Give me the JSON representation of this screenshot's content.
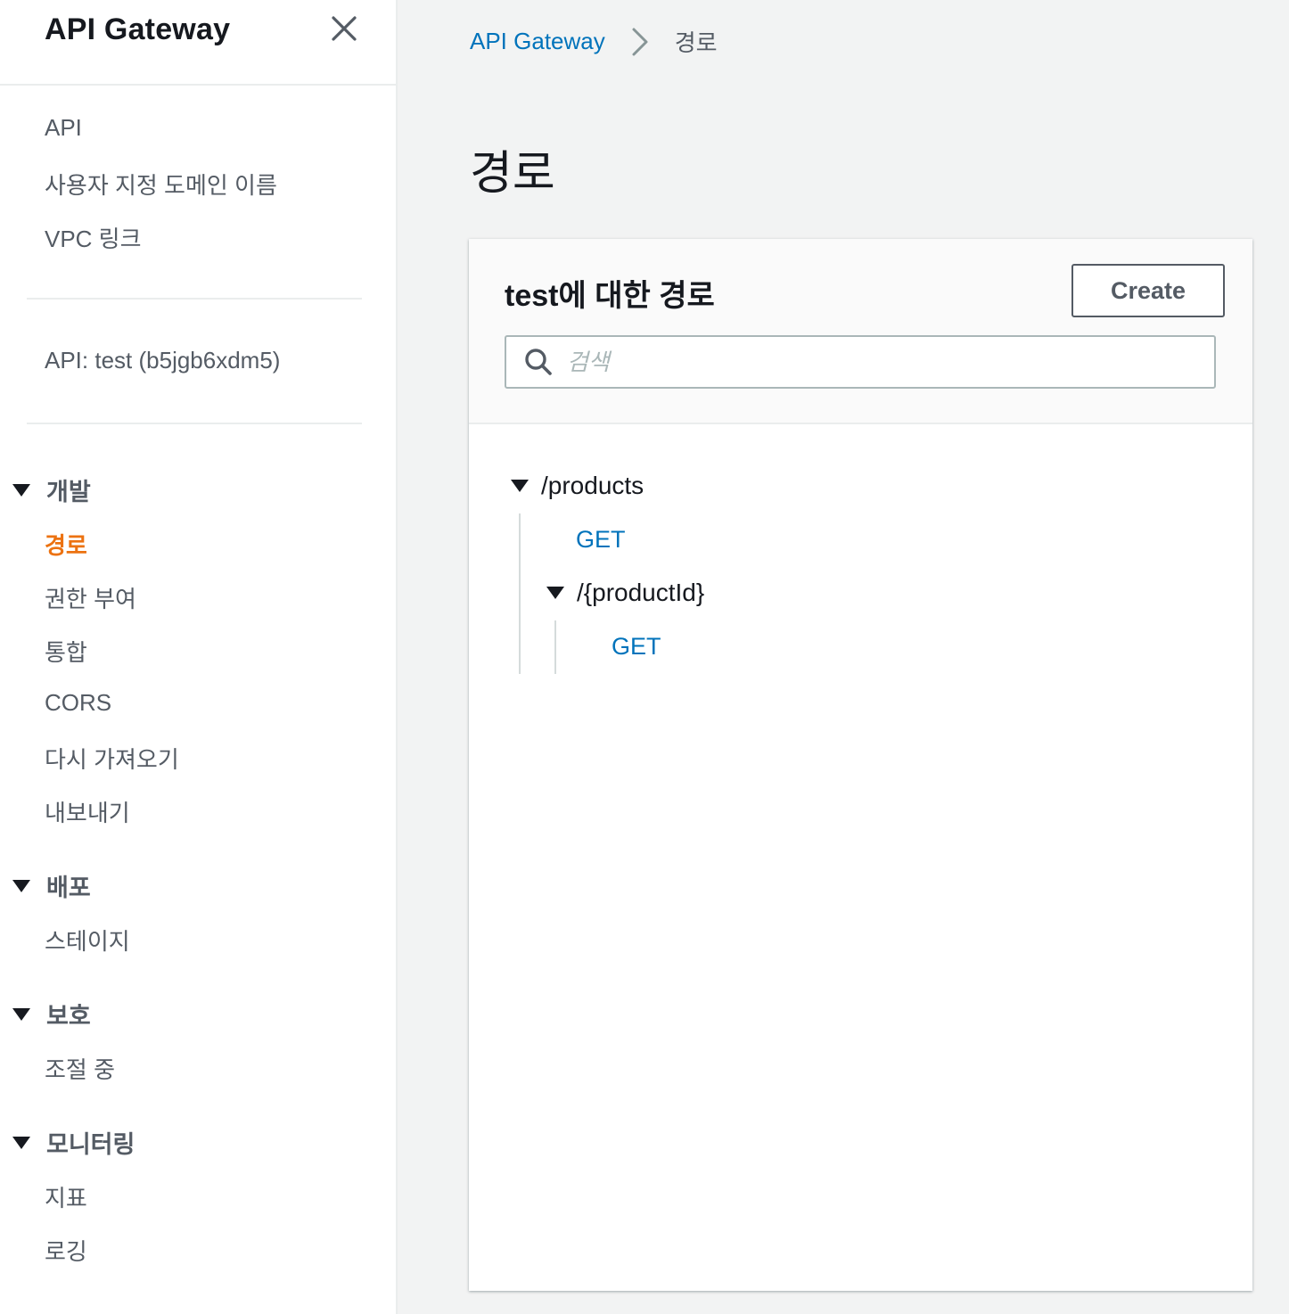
{
  "sidebar": {
    "title": "API Gateway",
    "top_links": [
      "API",
      "사용자 지정 도메인 이름",
      "VPC 링크"
    ],
    "api_label": "API: test (b5jgb6xdm5)",
    "sections": [
      {
        "label": "개발",
        "items": [
          "경로",
          "권한 부여",
          "통합",
          "CORS",
          "다시 가져오기",
          "내보내기"
        ]
      },
      {
        "label": "배포",
        "items": [
          "스테이지"
        ]
      },
      {
        "label": "보호",
        "items": [
          "조절 중"
        ]
      },
      {
        "label": "모니터링",
        "items": [
          "지표",
          "로깅"
        ]
      }
    ],
    "active_item": "경로"
  },
  "breadcrumb": {
    "root": "API Gateway",
    "current": "경로"
  },
  "page_title": "경로",
  "panel": {
    "title": "test에 대한 경로",
    "create_label": "Create",
    "search_placeholder": "검색"
  },
  "routes": {
    "root_path": "/products",
    "root_method": "GET",
    "child_path": "/{productId}",
    "child_method": "GET"
  },
  "colors": {
    "accent_orange": "#ec7211",
    "link_blue": "#0073bb",
    "text_gray": "#545b64",
    "background": "#f2f3f3"
  }
}
